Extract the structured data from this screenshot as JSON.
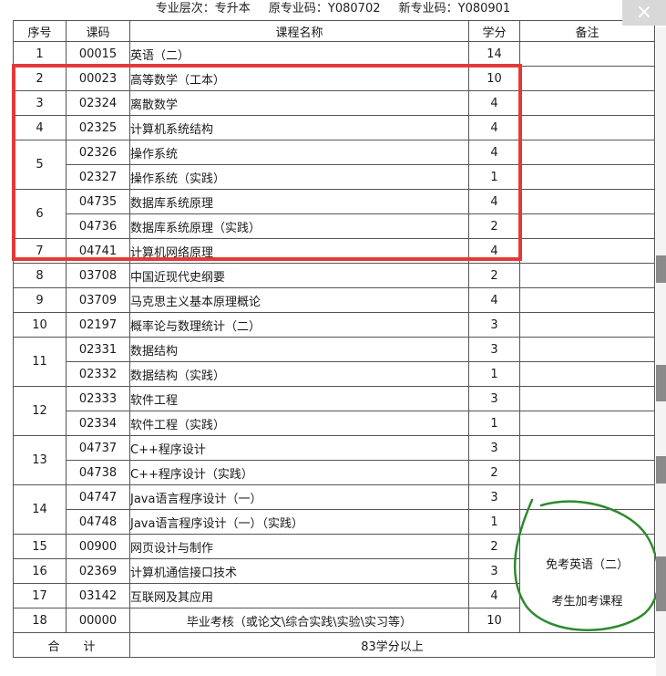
{
  "header": {
    "level": "专业层次：专升本",
    "old_code": "原专业码：Y080702",
    "new_code": "新专业码：Y080901"
  },
  "overlay": {
    "close_glyph": "×"
  },
  "table": {
    "columns": [
      "序号",
      "课码",
      "课程名称",
      "学分",
      "备注"
    ],
    "rows": [
      {
        "no": "1",
        "code": "00015",
        "name": "英语（二）",
        "credit": "14"
      },
      {
        "no": "2",
        "code": "00023",
        "name": "高等数学（工本）",
        "credit": "10"
      },
      {
        "no": "3",
        "code": "02324",
        "name": "离散数学",
        "credit": "4"
      },
      {
        "no": "4",
        "code": "02325",
        "name": "计算机系统结构",
        "credit": "4"
      },
      {
        "no": "5",
        "code": "02326",
        "name": "操作系统",
        "credit": "4"
      },
      {
        "no": "",
        "code": "02327",
        "name": "操作系统（实践）",
        "credit": "1"
      },
      {
        "no": "6",
        "code": "04735",
        "name": "数据库系统原理",
        "credit": "4"
      },
      {
        "no": "",
        "code": "04736",
        "name": "数据库系统原理（实践）",
        "credit": "2"
      },
      {
        "no": "7",
        "code": "04741",
        "name": "计算机网络原理",
        "credit": "4"
      },
      {
        "no": "8",
        "code": "03708",
        "name": "中国近现代史纲要",
        "credit": "2"
      },
      {
        "no": "9",
        "code": "03709",
        "name": "马克思主义基本原理概论",
        "credit": "4"
      },
      {
        "no": "10",
        "code": "02197",
        "name": "概率论与数理统计（二）",
        "credit": "3"
      },
      {
        "no": "11",
        "code": "02331",
        "name": "数据结构",
        "credit": "3"
      },
      {
        "no": "",
        "code": "02332",
        "name": "数据结构（实践）",
        "credit": "1"
      },
      {
        "no": "12",
        "code": "02333",
        "name": "软件工程",
        "credit": "3"
      },
      {
        "no": "",
        "code": "02334",
        "name": "软件工程（实践）",
        "credit": "1"
      },
      {
        "no": "13",
        "code": "04737",
        "name": "C++程序设计",
        "credit": "3"
      },
      {
        "no": "",
        "code": "04738",
        "name": "C++程序设计（实践）",
        "credit": "2"
      },
      {
        "no": "14",
        "code": "04747",
        "name": "Java语言程序设计（一）",
        "credit": "3"
      },
      {
        "no": "",
        "code": "04748",
        "name": "Java语言程序设计（一）（实践）",
        "credit": "1"
      },
      {
        "no": "15",
        "code": "00900",
        "name": "网页设计与制作",
        "credit": "2"
      },
      {
        "no": "16",
        "code": "02369",
        "name": "计算机通信接口技术",
        "credit": "3"
      },
      {
        "no": "17",
        "code": "03142",
        "name": "互联网及其应用",
        "credit": "4"
      },
      {
        "no": "18",
        "code": "00000",
        "name": "毕业考核（或论文\\综合实践\\实验\\实习等）",
        "credit": "10"
      }
    ],
    "remark_lines": [
      "免考英语（二）",
      "考生加考课程"
    ],
    "total_label": "合　　计",
    "total_value": "83学分以上"
  },
  "colors": {
    "highlight_red": "#e23a3a",
    "annotation_green": "#2d8a2d"
  }
}
